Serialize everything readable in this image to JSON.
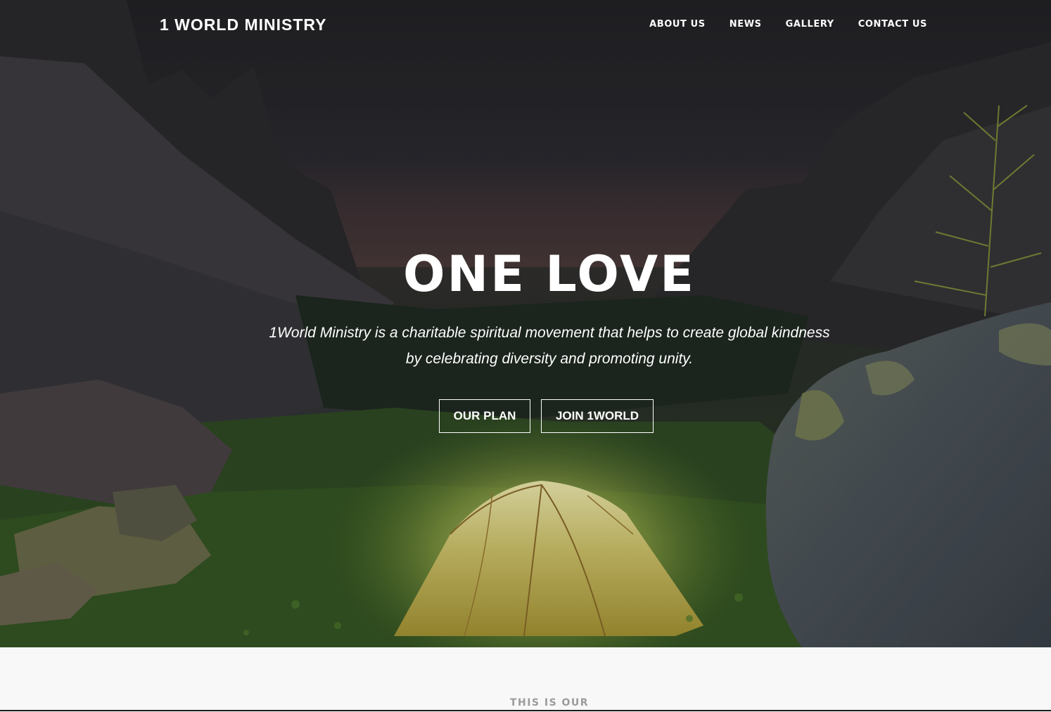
{
  "header": {
    "brand": "1 WORLD MINISTRY",
    "nav": [
      {
        "label": "ABOUT US"
      },
      {
        "label": "NEWS"
      },
      {
        "label": "GALLERY"
      },
      {
        "label": "CONTACT US"
      }
    ]
  },
  "hero": {
    "headline": "ONE LOVE",
    "tagline_line1": "1World Ministry is a charitable spiritual movement that helps to create global kindness",
    "tagline_line2": "by celebrating diversity and promoting unity.",
    "buttons": {
      "plan_label": "OUR PLAN",
      "join_label": "JOIN 1WORLD"
    },
    "background": "mountain-camp-tent-photo"
  },
  "next_section": {
    "eyebrow": "THIS IS OUR"
  },
  "colors": {
    "hero_text": "#ffffff",
    "section_bg": "#f7f8f7",
    "eyebrow": "#9b9b9b"
  }
}
